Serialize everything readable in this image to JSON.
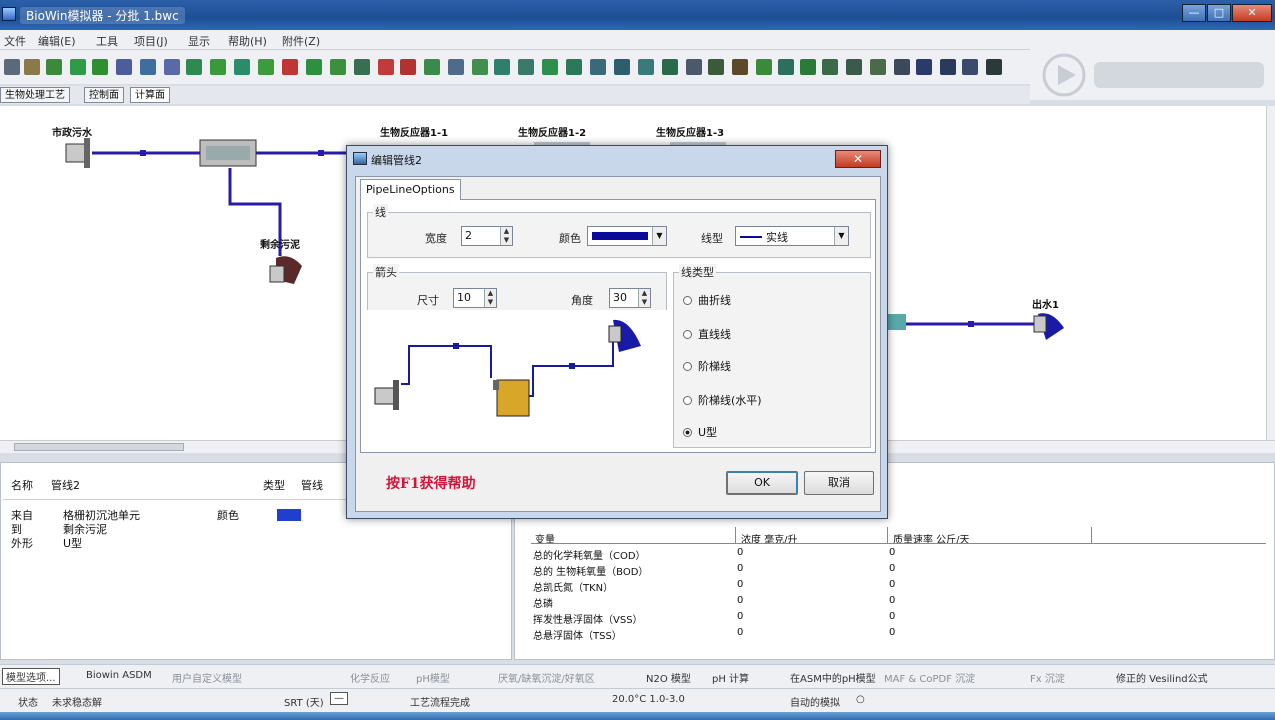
{
  "window": {
    "title": "BioWin模拟器 - 分批 1.bwc",
    "min": "—",
    "max": "□",
    "close": "✕"
  },
  "menu": [
    "文件",
    "编辑(E)",
    "工具",
    "项目(J)",
    "显示",
    "帮助(H)",
    "附件(Z)"
  ],
  "tabs": [
    "生物处理工艺",
    "控制面",
    "计算面"
  ],
  "canvas": {
    "labels": {
      "influent": "市政污水",
      "bio1": "生物反应器1-1",
      "bio2": "生物反应器1-2",
      "bio3": "生物反应器1-3",
      "sludge": "剩余污泥",
      "effluent": "出水1"
    },
    "line_color": "#2a1aa8"
  },
  "props": {
    "name_label": "名称",
    "name_value": "管线2",
    "type_label": "类型",
    "type_value": "管线",
    "from_label": "来自",
    "from_value": "格栅初沉池单元",
    "to_label": "到",
    "to_value": "剩余污泥",
    "shape_label": "外形",
    "shape_value": "U型",
    "color_label": "颜色",
    "color_value": "#1f3fcf"
  },
  "grid": {
    "headers": [
      "变量",
      "浓度 毫克/升",
      "质量速率 公斤/天"
    ],
    "rows": [
      [
        "总的化学耗氧量（COD）",
        "0",
        "0"
      ],
      [
        "总的 生物耗氧量（BOD）",
        "0",
        "0"
      ],
      [
        "总凯氏氮（TKN）",
        "0",
        "0"
      ],
      [
        "总磷",
        "0",
        "0"
      ],
      [
        "挥发性悬浮固体（VSS）",
        "0",
        "0"
      ],
      [
        "总悬浮固体（TSS）",
        "0",
        "0"
      ]
    ]
  },
  "status1": {
    "model_btn": "模型选项...",
    "bioasm": "Biowin ASDM",
    "user_model": "用户自定义模型",
    "kinetics": "化学反应",
    "ph": "pH模型",
    "hydro": "厌氧/缺氧沉淀/好氧区",
    "n2o": "N2O 模型",
    "ph_calc": "pH 计算",
    "abs": "在ASM中的pH模型",
    "maf": "MAF & CoPDF 沉淀",
    "fx": "Fx 沉淀",
    "vesilind": "修正的 Vesilind公式"
  },
  "status2": {
    "state_label": "状态",
    "state_value": "未求稳态解",
    "srt_label": "SRT (天)",
    "srt_value": "—",
    "process": "工艺流程完成",
    "temp": "20.0°C  1.0-3.0",
    "auto": "自动的模拟"
  },
  "dialog": {
    "title": "编辑管线2",
    "close": "✕",
    "tab": "PipeLineOptions",
    "line_group": "线",
    "width_label": "宽度",
    "width_value": "2",
    "color_label": "颜色",
    "color_value": "#0a0a9a",
    "style_label": "线型",
    "style_value": "实线",
    "arrow_group": "箭头",
    "size_label": "尺寸",
    "size_value": "10",
    "angle_label": "角度",
    "angle_value": "30",
    "linetype_group": "线类型",
    "radios": [
      {
        "label": "曲折线",
        "checked": false
      },
      {
        "label": "直线线",
        "checked": false
      },
      {
        "label": "阶梯线",
        "checked": false
      },
      {
        "label": "阶梯线(水平)",
        "checked": false
      },
      {
        "label": "U型",
        "checked": true
      }
    ],
    "help": "按F1获得帮助",
    "ok": "OK",
    "cancel": "取消"
  }
}
